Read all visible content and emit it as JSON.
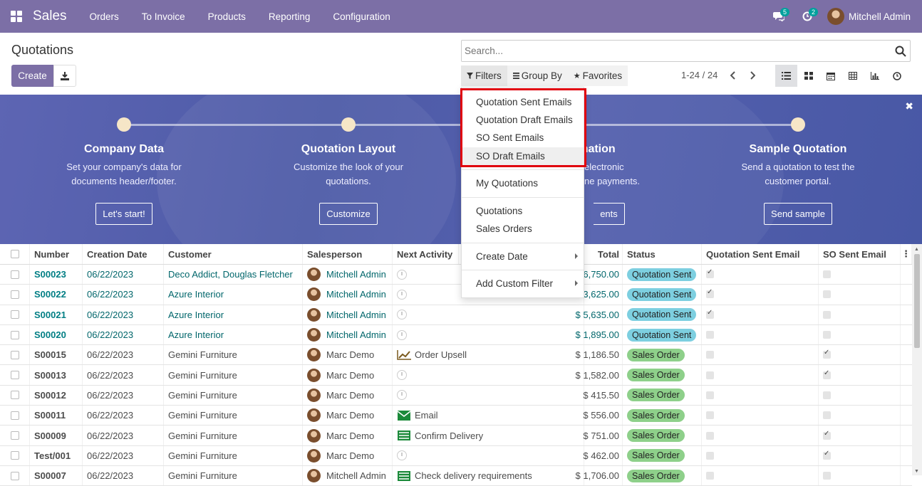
{
  "navbar": {
    "brand": "Sales",
    "menu": [
      "Orders",
      "To Invoice",
      "Products",
      "Reporting",
      "Configuration"
    ],
    "messages_badge": "5",
    "activities_badge": "2",
    "user_name": "Mitchell Admin"
  },
  "control": {
    "page_title": "Quotations",
    "create_label": "Create",
    "search_placeholder": "Search...",
    "filters_label": "Filters",
    "groupby_label": "Group By",
    "favorites_label": "Favorites",
    "pager": "1-24 / 24"
  },
  "banner": {
    "steps": [
      {
        "title": "Company Data",
        "desc": "Set your company's data for documents header/footer.",
        "button": "Let's start!"
      },
      {
        "title": "Quotation Layout",
        "desc": "Customize the look of your quotations.",
        "button": "Customize"
      },
      {
        "title": "rmation",
        "desc": "electronic",
        "desc2": "ne payments.",
        "button": "ents"
      },
      {
        "title": "Sample Quotation",
        "desc": "Send a quotation to test the customer portal.",
        "button": "Send sample"
      }
    ]
  },
  "filters_dropdown": {
    "group1": [
      "Quotation Sent Emails",
      "Quotation Draft Emails",
      "SO Sent Emails",
      "SO Draft Emails"
    ],
    "my_quotations": "My Quotations",
    "group2": [
      "Quotations",
      "Sales Orders"
    ],
    "create_date": "Create Date",
    "add_custom": "Add Custom Filter"
  },
  "table": {
    "headers": {
      "number": "Number",
      "creation_date": "Creation Date",
      "customer": "Customer",
      "salesperson": "Salesperson",
      "next_activity": "Next Activity",
      "total": "Total",
      "status": "Status",
      "quotation_sent_email": "Quotation Sent Email",
      "so_sent_email": "SO Sent Email"
    },
    "rows": [
      {
        "number": "S00023",
        "date": "06/22/2023",
        "customer": "Deco Addict, Douglas Fletcher",
        "salesperson": "Mitchell Admin",
        "activity": "",
        "total": "6,750.00",
        "status": "Quotation Sent"
      },
      {
        "number": "S00022",
        "date": "06/22/2023",
        "customer": "Azure Interior",
        "salesperson": "Mitchell Admin",
        "activity": "",
        "total": "$ 13,625.00",
        "status": "Quotation Sent"
      },
      {
        "number": "S00021",
        "date": "06/22/2023",
        "customer": "Azure Interior",
        "salesperson": "Mitchell Admin",
        "activity": "",
        "total": "$ 5,635.00",
        "status": "Quotation Sent"
      },
      {
        "number": "S00020",
        "date": "06/22/2023",
        "customer": "Azure Interior",
        "salesperson": "Mitchell Admin",
        "activity": "",
        "total": "$ 1,895.00",
        "status": "Quotation Sent"
      },
      {
        "number": "S00015",
        "date": "06/22/2023",
        "customer": "Gemini Furniture",
        "salesperson": "Marc Demo",
        "activity": "Order Upsell",
        "total": "$ 1,186.50",
        "status": "Sales Order"
      },
      {
        "number": "S00013",
        "date": "06/22/2023",
        "customer": "Gemini Furniture",
        "salesperson": "Marc Demo",
        "activity": "",
        "total": "$ 1,582.00",
        "status": "Sales Order"
      },
      {
        "number": "S00012",
        "date": "06/22/2023",
        "customer": "Gemini Furniture",
        "salesperson": "Marc Demo",
        "activity": "",
        "total": "$ 415.50",
        "status": "Sales Order"
      },
      {
        "number": "S00011",
        "date": "06/22/2023",
        "customer": "Gemini Furniture",
        "salesperson": "Marc Demo",
        "activity": "Email",
        "total": "$ 556.00",
        "status": "Sales Order"
      },
      {
        "number": "S00009",
        "date": "06/22/2023",
        "customer": "Gemini Furniture",
        "salesperson": "Marc Demo",
        "activity": "Confirm Delivery",
        "total": "$ 751.00",
        "status": "Sales Order"
      },
      {
        "number": "Test/001",
        "date": "06/22/2023",
        "customer": "Gemini Furniture",
        "salesperson": "Marc Demo",
        "activity": "",
        "total": "$ 462.00",
        "status": "Sales Order"
      },
      {
        "number": "S00007",
        "date": "06/22/2023",
        "customer": "Gemini Furniture",
        "salesperson": "Mitchell Admin",
        "activity": "Check delivery requirements",
        "total": "$ 1,706.00",
        "status": "Sales Order"
      }
    ]
  },
  "colors": {
    "navbar": "#7c6fa6",
    "link": "#017e84",
    "quotation_sent_badge": "#7dcfe0",
    "sales_order_badge": "#8ed08a",
    "highlight": "#e0000d"
  }
}
